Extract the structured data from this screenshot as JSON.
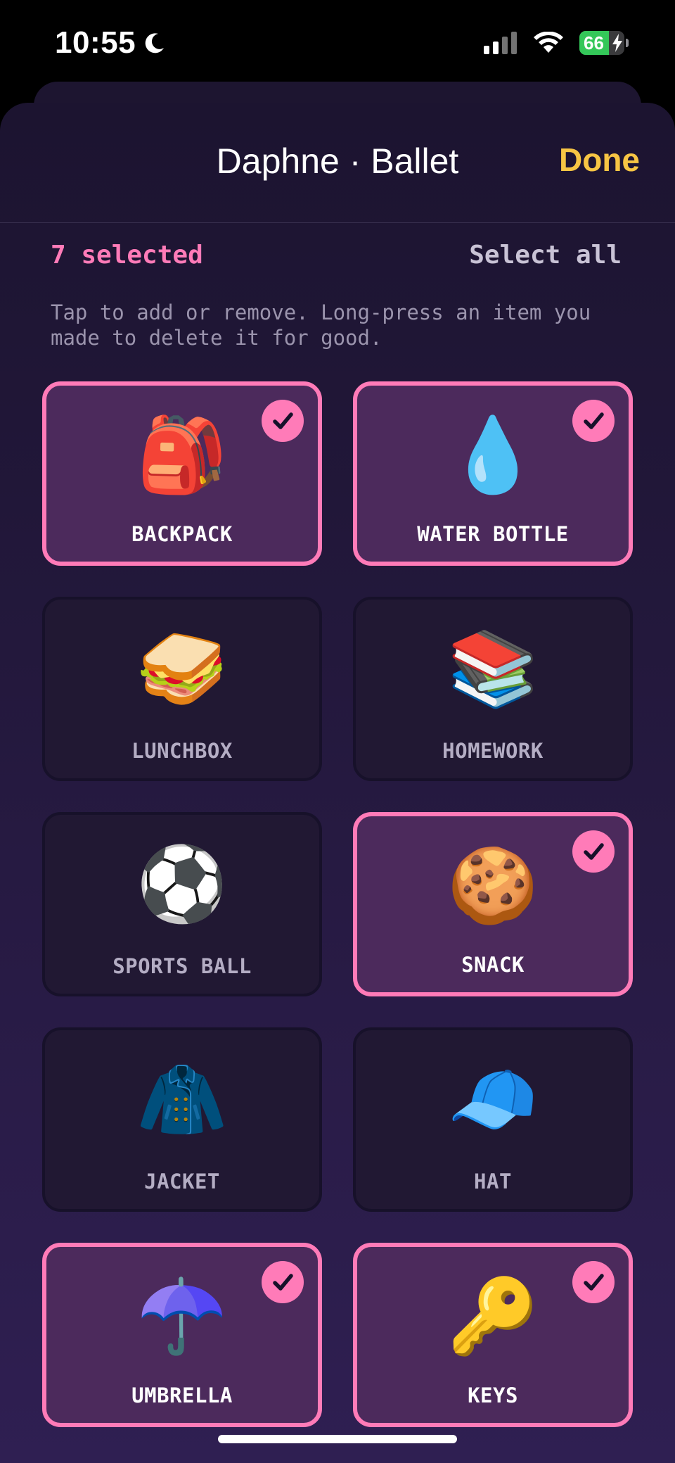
{
  "status_bar": {
    "time": "10:55",
    "battery_level": "66",
    "battery_fraction": 0.66,
    "icons": [
      "moon-icon",
      "cellular-signal-icon",
      "wifi-icon",
      "battery-icon",
      "charging-bolt-icon"
    ]
  },
  "nav": {
    "title": "Daphne · Ballet",
    "done_label": "Done"
  },
  "selection": {
    "count_label": "7 selected",
    "select_all_label": "Select all"
  },
  "hint": "Tap to add or remove. Long-press an item you made to delete it for good.",
  "items": [
    {
      "label": "BACKPACK",
      "emoji": "🎒",
      "selected": true
    },
    {
      "label": "WATER BOTTLE",
      "emoji": "💧",
      "selected": true
    },
    {
      "label": "LUNCHBOX",
      "emoji": "🥪",
      "selected": false
    },
    {
      "label": "HOMEWORK",
      "emoji": "📚",
      "selected": false
    },
    {
      "label": "SPORTS BALL",
      "emoji": "⚽",
      "selected": false
    },
    {
      "label": "SNACK",
      "emoji": "🍪",
      "selected": true
    },
    {
      "label": "JACKET",
      "emoji": "🧥",
      "selected": false
    },
    {
      "label": "HAT",
      "emoji": "🧢",
      "selected": false
    },
    {
      "label": "UMBRELLA",
      "emoji": "☂️",
      "selected": true
    },
    {
      "label": "KEYS",
      "emoji": "🔑",
      "selected": true
    }
  ],
  "colors": {
    "accent_pink": "#ff7bb8",
    "done_yellow": "#f7c544",
    "sheet_background": "#1c1430",
    "tile_selected": "#4c2a5c",
    "tile_unselected": "#211833"
  }
}
